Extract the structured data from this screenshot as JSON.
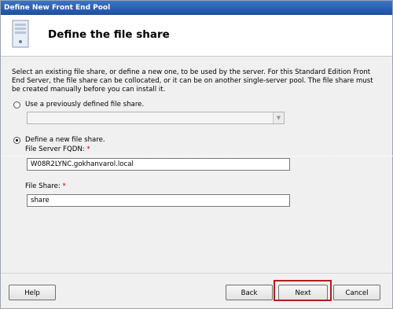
{
  "window": {
    "title": "Define New Front End Pool"
  },
  "header": {
    "title": "Define the file share",
    "icon": "server-icon"
  },
  "description": "Select an existing file share, or define a new one, to be used by the server. For this Standard Edition Front End Server, the file share can be collocated, or it can be on another single-server pool.  The file share must be created manually before you can install it.",
  "options": {
    "use_existing": {
      "label": "Use a previously defined file share.",
      "checked": false
    },
    "define_new": {
      "label": "Define a new file share.",
      "checked": true
    }
  },
  "existing_dropdown": {
    "value": ""
  },
  "fqdn": {
    "label": "File Server FQDN:",
    "required_mark": "*",
    "value": "W08R2LYNC.gokhanvarol.local"
  },
  "share": {
    "label": "File Share:",
    "required_mark": "*",
    "value": "share"
  },
  "buttons": {
    "help": "Help",
    "back": "Back",
    "next": "Next",
    "cancel": "Cancel"
  }
}
